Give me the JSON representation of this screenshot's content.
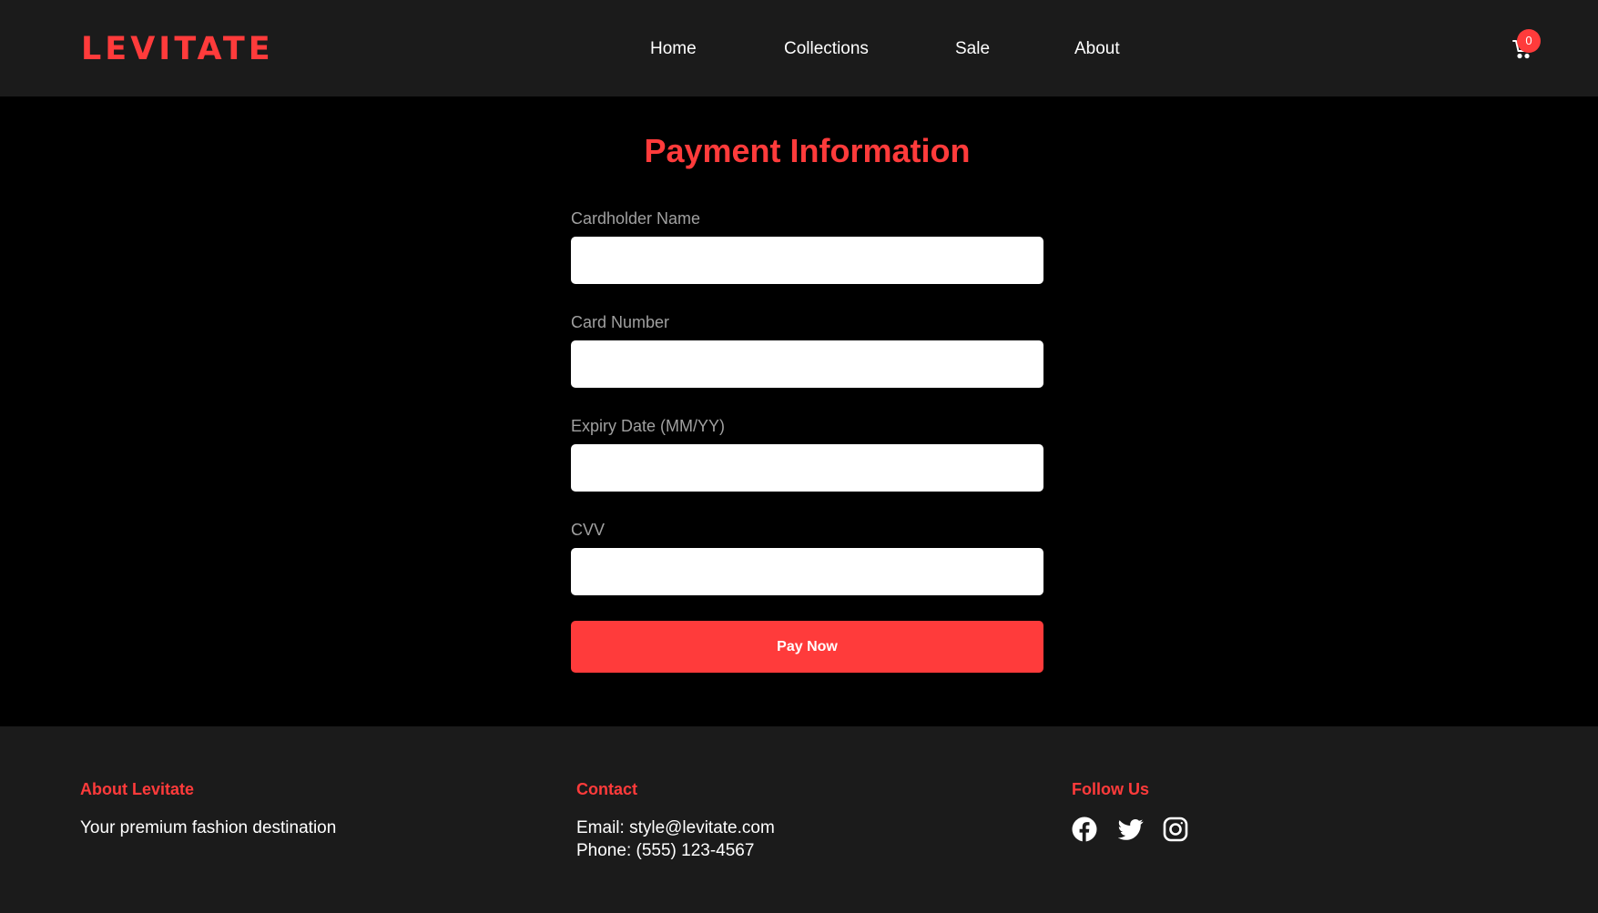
{
  "brand": {
    "logo": "LEVITATE",
    "accent_color": "#ff3b3b"
  },
  "nav": {
    "items": [
      {
        "label": "Home"
      },
      {
        "label": "Collections"
      },
      {
        "label": "Sale"
      },
      {
        "label": "About"
      }
    ],
    "cart": {
      "icon": "cart-icon",
      "count": "0"
    }
  },
  "payment_form": {
    "title": "Payment Information",
    "fields": [
      {
        "label": "Cardholder Name",
        "value": ""
      },
      {
        "label": "Card Number",
        "value": ""
      },
      {
        "label": "Expiry Date (MM/YY)",
        "value": ""
      },
      {
        "label": "CVV",
        "value": ""
      }
    ],
    "submit_label": "Pay Now"
  },
  "footer": {
    "about": {
      "heading": "About Levitate",
      "text": "Your premium fashion destination"
    },
    "contact": {
      "heading": "Contact",
      "email": "Email: style@levitate.com",
      "phone": "Phone: (555) 123-4567"
    },
    "follow": {
      "heading": "Follow Us",
      "icons": [
        "facebook-icon",
        "twitter-icon",
        "instagram-icon"
      ]
    }
  }
}
